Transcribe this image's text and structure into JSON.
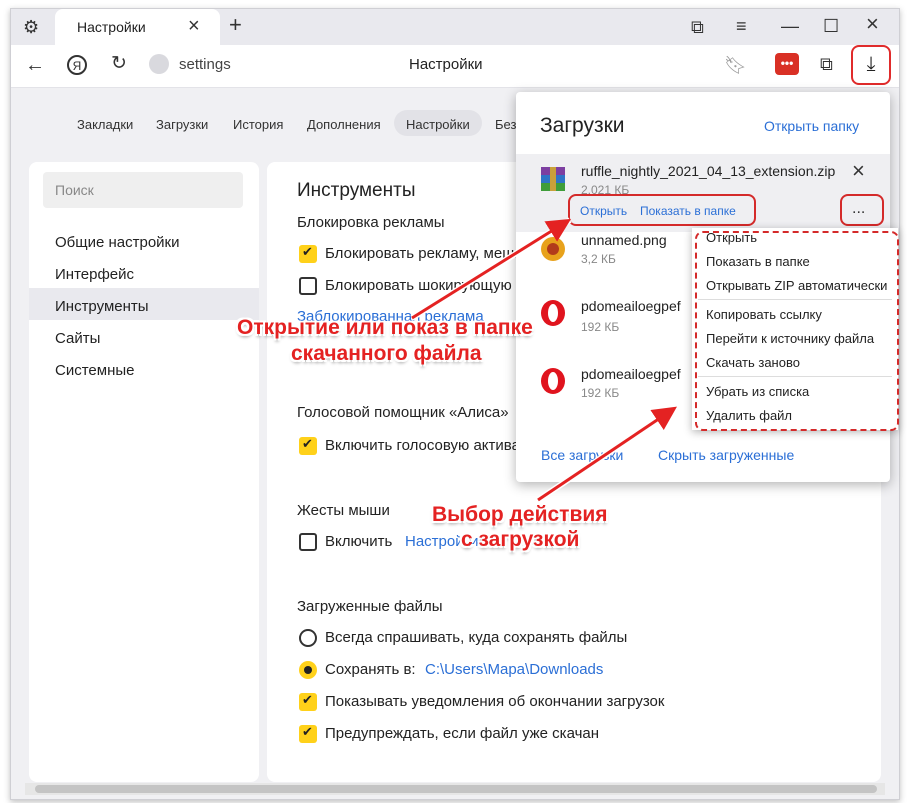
{
  "tab": {
    "title": "Настройки"
  },
  "address": {
    "url_text": "settings",
    "page_title": "Настройки",
    "ext_badge": "•••"
  },
  "topnav": {
    "items": [
      "Закладки",
      "Загрузки",
      "История",
      "Дополнения",
      "Настройки",
      "Безо"
    ],
    "active": "Настройки"
  },
  "sidebar": {
    "search_placeholder": "Поиск",
    "items": [
      "Общие настройки",
      "Интерфейс",
      "Инструменты",
      "Сайты",
      "Системные"
    ],
    "active": "Инструменты"
  },
  "main": {
    "section_title": "Инструменты",
    "adblock": {
      "heading": "Блокировка рекламы",
      "opt1": "Блокировать рекламу, меша",
      "opt2": "Блокировать шокирующую",
      "link": "Заблокированная реклама"
    },
    "voice": {
      "heading": "Голосовой помощник «Алиса»",
      "opt1": "Включить голосовую актива"
    },
    "gestures": {
      "heading": "Жесты мыши",
      "opt1": "Включить",
      "link": "Настройки"
    },
    "downloads": {
      "heading": "Загруженные файлы",
      "opt_ask": "Всегда спрашивать, куда сохранять файлы",
      "opt_save": "Сохранять в:",
      "save_path": "C:\\Users\\Mapa\\Downloads",
      "opt_notify": "Показывать уведомления об окончании загрузок",
      "opt_warn": "Предупреждать, если файл уже скачан"
    }
  },
  "download_panel": {
    "title": "Загрузки",
    "open_folder": "Открыть папку",
    "items": [
      {
        "name": "ruffle_nightly_2021_04_13_extension.zip",
        "size": "2,021 КБ",
        "icon": "winrar-icon"
      },
      {
        "name": "unnamed.png",
        "size": "3,2 КБ",
        "icon": "image-icon"
      },
      {
        "name": "pdomeailoegpef",
        "size": "192 КБ",
        "icon": "opera-icon"
      },
      {
        "name": "pdomeailoegpef",
        "size": "192 КБ",
        "icon": "opera-icon"
      }
    ],
    "action_open": "Открыть",
    "action_show": "Показать в папке",
    "more": "...",
    "all_downloads": "Все загрузки",
    "hide_downloaded": "Скрыть загруженные"
  },
  "context_menu": {
    "items": [
      "Открыть",
      "Показать в папке",
      "Открывать ZIP автоматически",
      "Копировать ссылку",
      "Перейти к источнику файла",
      "Скачать заново",
      "Убрать из списка",
      "Удалить файл"
    ]
  },
  "annotations": {
    "callout1_line1": "Открытие или показ в папке",
    "callout1_line2": "скачанного файла",
    "callout2_line1": "Выбор действия",
    "callout2_line2": "с загрузкой"
  },
  "colors": {
    "accent": "#ffd11a",
    "link": "#2b6fd6",
    "annotation": "#e42222"
  }
}
